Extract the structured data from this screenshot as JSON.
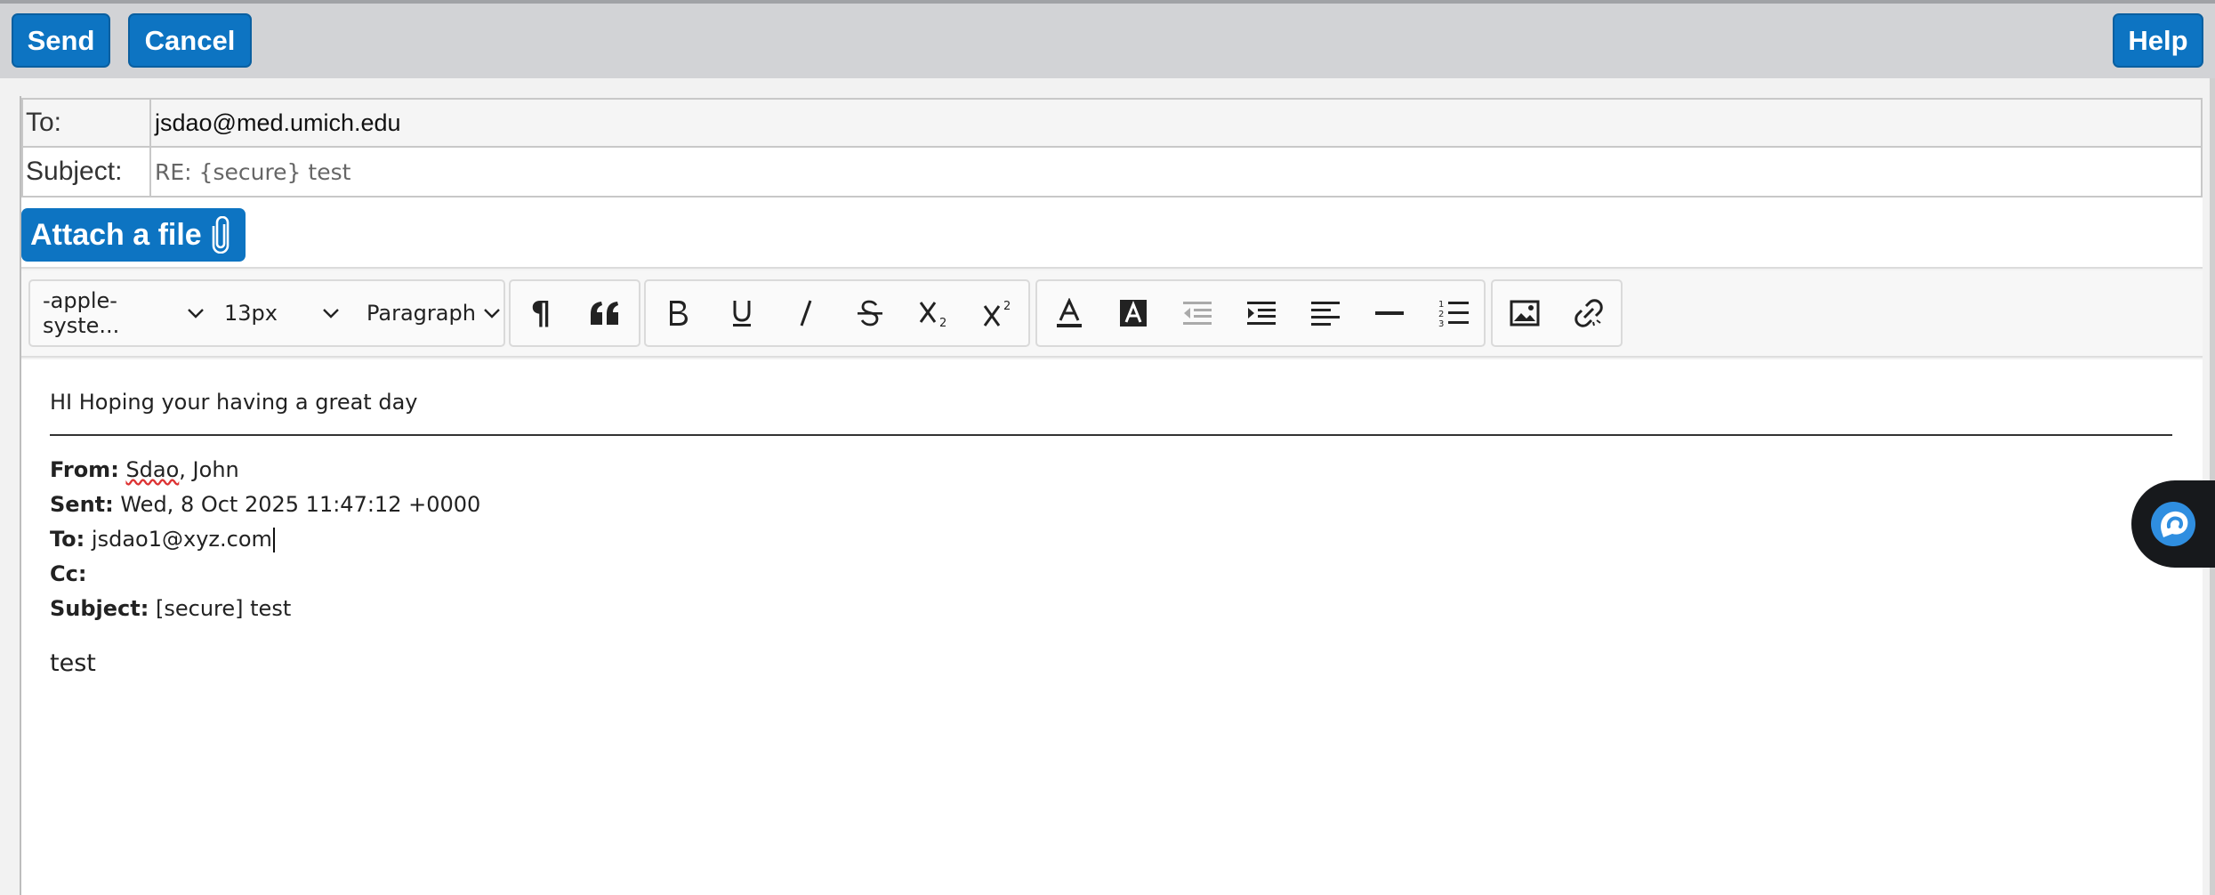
{
  "toolbar": {
    "send_label": "Send",
    "cancel_label": "Cancel",
    "help_label": "Help"
  },
  "headers": {
    "to_label": "To:",
    "to_value": "jsdao@med.umich.edu",
    "subject_label": "Subject:",
    "subject_value": "RE: {secure} test"
  },
  "attach": {
    "label": "Attach a file"
  },
  "editor_toolbar": {
    "font_family": "-apple-syste...",
    "font_size": "13px",
    "block_format": "Paragraph",
    "buttons": [
      "pilcrow-icon",
      "quote-icon",
      "bold-icon",
      "underline-icon",
      "italic-icon",
      "strikethrough-icon",
      "subscript-icon",
      "superscript-icon",
      "text-color-icon",
      "highlight-color-icon",
      "outdent-icon",
      "indent-icon",
      "align-left-icon",
      "horizontal-rule-icon",
      "numbered-list-icon",
      "insert-image-icon",
      "unlink-icon"
    ]
  },
  "body": {
    "reply_text": "HI Hoping your having a great day",
    "from_label": "From:",
    "from_value_1": "Sdao",
    "from_value_2": ", John",
    "sent_label": "Sent:",
    "sent_value": "Wed, 8 Oct 2025 11:47:12 +0000",
    "to_label": "To:",
    "to_value": "jsdao1@xyz.com",
    "cc_label": "Cc:",
    "cc_value": "",
    "subject_label": "Subject:",
    "subject_value": "[secure] test",
    "original_text": "test"
  },
  "colors": {
    "accent": "#0d74c2",
    "topbar": "#d2d3d6",
    "disabled_icon": "#aaaaaa"
  }
}
